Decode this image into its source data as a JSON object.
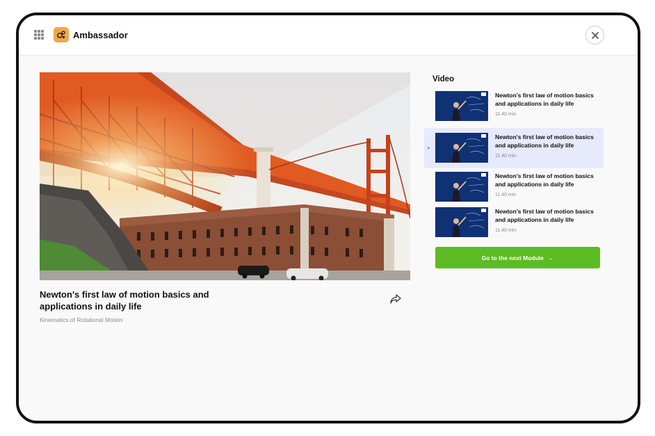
{
  "app": {
    "name": "Ambassador"
  },
  "icons": {
    "menu": "grid-icon",
    "logo": "ambassador-logo-icon",
    "close": "close-icon",
    "share": "share-icon",
    "next": "arrow-right-icon"
  },
  "main": {
    "title": "Newton's first law of motion basics and applications in daily life",
    "subtitle": "Kinematics of Rotational Motion"
  },
  "sidebar": {
    "heading": "Video",
    "items": [
      {
        "title": "Newton's first law of motion basics and applications in daily life",
        "duration": "11.40 min",
        "active": false
      },
      {
        "title": "Newton's first law of motion basics and applications in daily life",
        "duration": "11.40 min",
        "active": true
      },
      {
        "title": "Newton's first law of motion basics and applications in daily life",
        "duration": "11.40 min",
        "active": false
      },
      {
        "title": "Newton's first law of motion basics and applications in daily life",
        "duration": "11.40 min",
        "active": false
      }
    ],
    "next_button": {
      "label": "Go to the next Module",
      "arrow": "→"
    }
  },
  "colors": {
    "accent_green": "#5dbb24",
    "active_item": "#e7e9fc",
    "logo_orange": "#f3a64a",
    "thumbnail_blue": "#0b2a66"
  }
}
